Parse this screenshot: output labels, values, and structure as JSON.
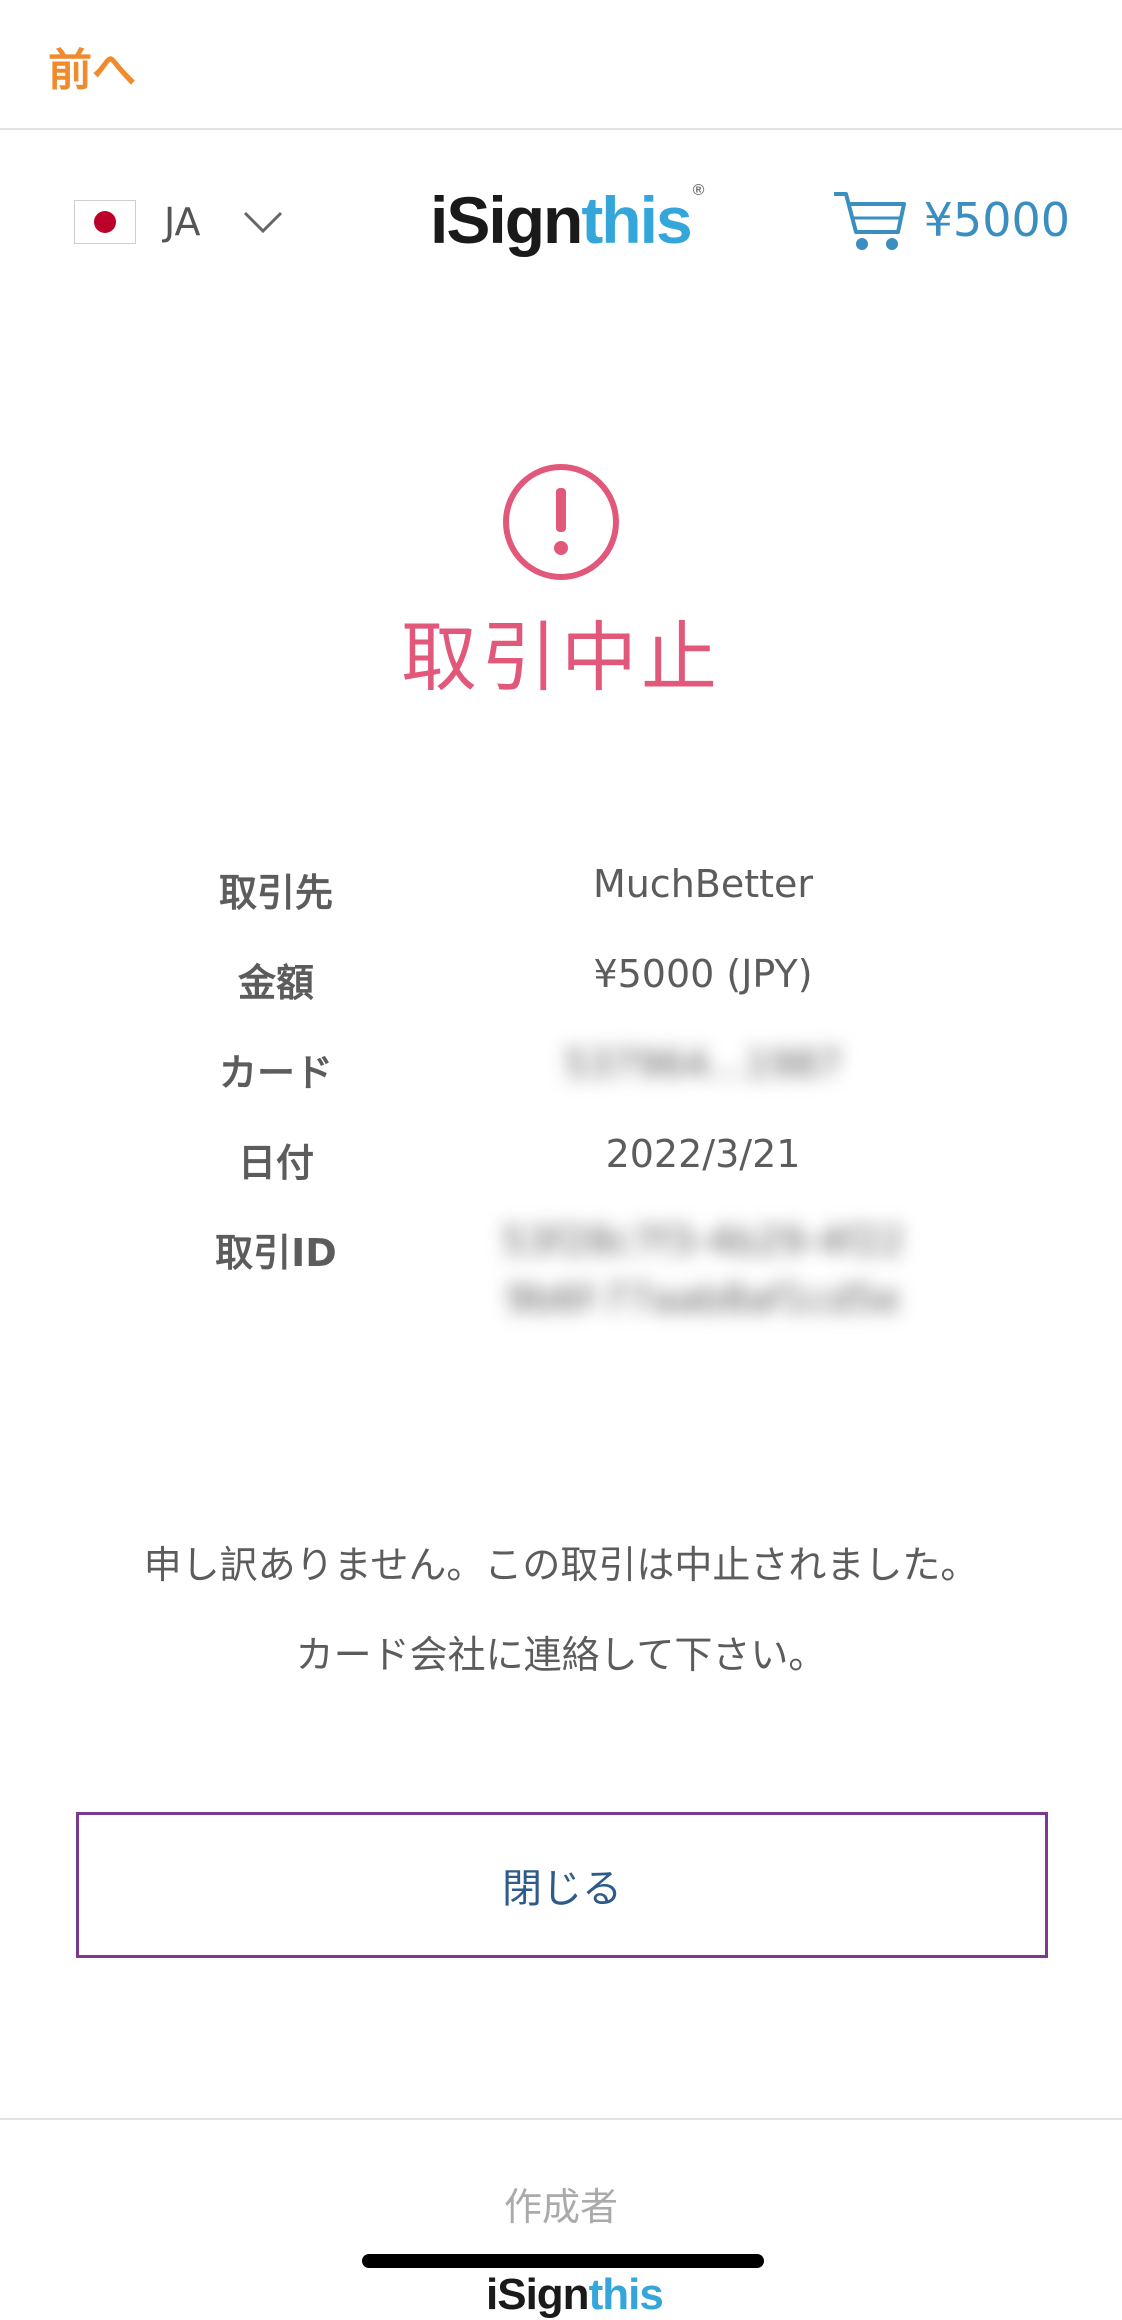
{
  "topbar": {
    "back_label": "前へ"
  },
  "header": {
    "language_code": "JA",
    "logo_part1": "iSign",
    "logo_part2": "this",
    "logo_mark": "®",
    "cart_amount": "¥5000"
  },
  "status": {
    "title": "取引中止",
    "icon": "alert-circle-icon",
    "color": "#e2587a"
  },
  "details": [
    {
      "label": "取引先",
      "value": "MuchBetter"
    },
    {
      "label": "金額",
      "value": "¥5000 (JPY)"
    },
    {
      "label": "カード",
      "value": "537964...1987"
    },
    {
      "label": "日付",
      "value": "2022/3/21"
    },
    {
      "label": "取引ID",
      "value_line1": "53f28c7f3-4b29-4f22",
      "value_line2": "9b6f-77aab8af1cd5e"
    }
  ],
  "message": {
    "line1": "申し訳ありません。この取引は中止されました。",
    "line2": "カード会社に連絡して下さい。"
  },
  "actions": {
    "close_label": "閉じる"
  },
  "footer": {
    "label": "作成者",
    "logo_part1": "iSign",
    "logo_part2": "this"
  },
  "colors": {
    "accent_orange": "#ef8a2d",
    "error_pink": "#e2587a",
    "button_border": "#7c3a8f",
    "link_blue": "#3a8fc0"
  }
}
